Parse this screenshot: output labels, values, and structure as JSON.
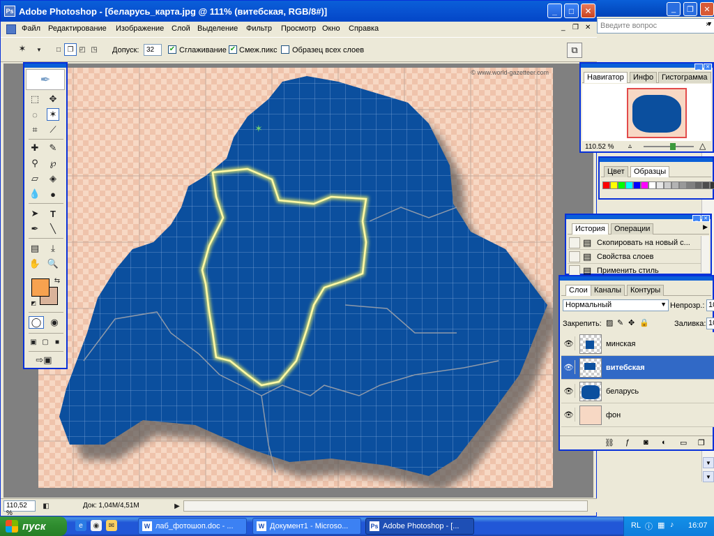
{
  "bg_window": {
    "help_placeholder": "Введите вопрос"
  },
  "ps": {
    "title": "Adobe Photoshop - [беларусь_карта.jpg @ 111% (витебская, RGB/8#)]",
    "menu": [
      "Файл",
      "Редактирование",
      "Изображение",
      "Слой",
      "Выделение",
      "Фильтр",
      "Просмотр",
      "Окно",
      "Справка"
    ],
    "options": {
      "tolerance_label": "Допуск:",
      "tolerance_value": "32",
      "antialias_label": "Сглаживание",
      "antialias_checked": true,
      "contiguous_label": "Смеж.пикс",
      "contiguous_checked": true,
      "sample_all_label": "Образец всех слоев",
      "sample_all_checked": false
    },
    "watermark": "© www.world-gazetteer.com",
    "status": {
      "zoom": "110,52 %",
      "doc_info": "Док: 1,04M/4,51M"
    },
    "fg_color": "#f7a24f",
    "bg_color": "#d9b39a"
  },
  "navigator": {
    "tabs": [
      "Навигатор",
      "Инфо",
      "Гистограмма"
    ],
    "zoom": "110.52 %"
  },
  "swatches": {
    "tabs": [
      "Цвет",
      "Образцы"
    ],
    "colors": [
      "#ff0000",
      "#ffff00",
      "#00ff00",
      "#00ffff",
      "#0000ff",
      "#ff00ff",
      "#ffffff",
      "#e6e6e6",
      "#cccccc",
      "#b3b3b3",
      "#999999",
      "#808080",
      "#666666",
      "#4d4d4d",
      "#333333"
    ]
  },
  "history": {
    "tabs": [
      "История",
      "Операции"
    ],
    "items": [
      "Скопировать на новый с...",
      "Свойства слоев",
      "Применить стиль"
    ]
  },
  "layers": {
    "tabs": [
      "Слои",
      "Каналы",
      "Контуры"
    ],
    "blend_mode": "Нормальный",
    "opacity_label": "Непрозр.:",
    "opacity_value": "10",
    "lock_label": "Закрепить:",
    "fill_label": "Заливка:",
    "fill_value": "10",
    "items": [
      {
        "name": "минская",
        "selected": false
      },
      {
        "name": "витебская",
        "selected": true
      },
      {
        "name": "беларусь",
        "selected": false
      },
      {
        "name": "фон",
        "selected": false
      }
    ]
  },
  "taskbar": {
    "start_label": "пуск",
    "buttons": [
      "лаб_фотошоп.doc - ...",
      "Документ1 - Microso...",
      "Adobe Photoshop - [..."
    ],
    "lang": "RL",
    "clock": "16:07"
  }
}
